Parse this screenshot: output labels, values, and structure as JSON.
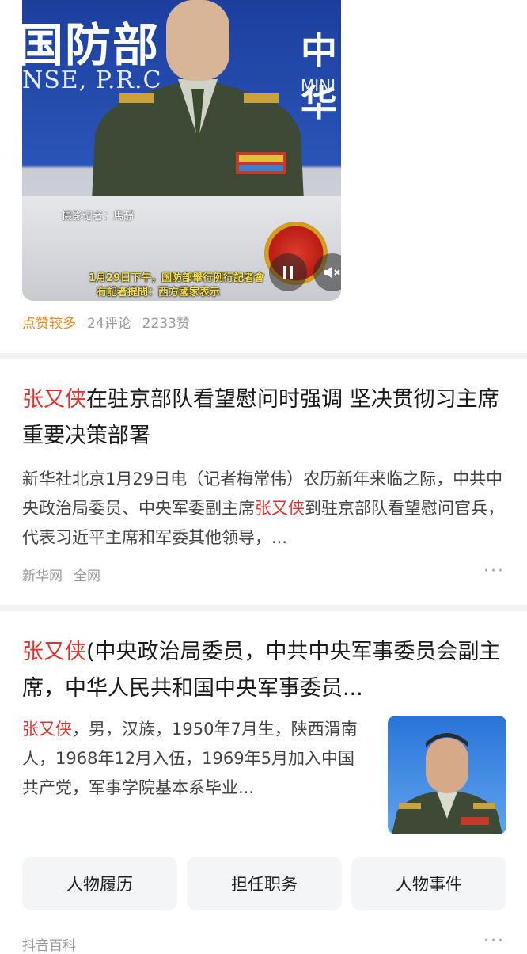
{
  "video_card": {
    "bg_text_left": "国防部",
    "bg_text_sub": "NSE, P.R.C",
    "bg_text_right": "中华",
    "bg_text_right2": "MINI",
    "credit": "摄影记者：馬靜",
    "subtitle_line1": "1月29日下午，国防部舉行例行記者會",
    "subtitle_line2": "有記者提問：西方國家表示",
    "hot_label": "点赞较多",
    "comments": "24评论",
    "likes": "2233赞"
  },
  "news_card": {
    "title_highlight": "张又侠",
    "title_rest": "在驻京部队看望慰问时强调 坚决贯彻习主席重要决策部署",
    "abstract_pre": "新华社北京1月29日电（记者梅常伟）农历新年来临之际，中共中央政治局委员、中央军委副主席",
    "abstract_highlight": "张又侠",
    "abstract_post": "到驻京部队看望慰问官兵，代表习近平主席和军委其他领导，...",
    "source": "新华网",
    "scope": "全网",
    "more": "···"
  },
  "baike_card": {
    "title_highlight": "张又侠",
    "title_rest": "(中央政治局委员，中共中央军事委员会副主席，中华人民共和国中央军事委员...",
    "abstract_highlight": "张又侠",
    "abstract_rest": "，男，汉族，1950年7月生，陕西渭南人，1968年12月入伍，1969年5月加入中国共产党，军事学院基本系毕业...",
    "buttons": [
      "人物履历",
      "担任职务",
      "人物事件"
    ],
    "source": "抖音百科",
    "more": "···"
  },
  "colors": {
    "highlight": "#e2322f",
    "hot": "#e8891a"
  }
}
